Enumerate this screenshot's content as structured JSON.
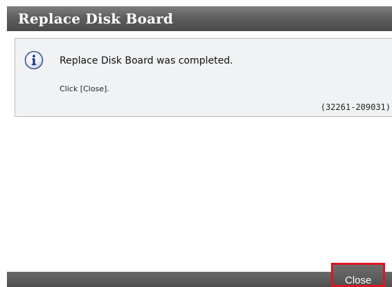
{
  "dialog": {
    "title": "Replace Disk Board"
  },
  "message": {
    "icon": "info-icon",
    "text": "Replace Disk Board was completed.",
    "instruction": "Click [Close].",
    "code": "(32261-209031)"
  },
  "footer": {
    "close_label": "Close",
    "close_highlight_color": "#e0141e"
  },
  "colors": {
    "title_bar": "#5e5e5e",
    "panel_background": "#f0f2f4",
    "info_icon_blue": "#1a3a8a"
  }
}
